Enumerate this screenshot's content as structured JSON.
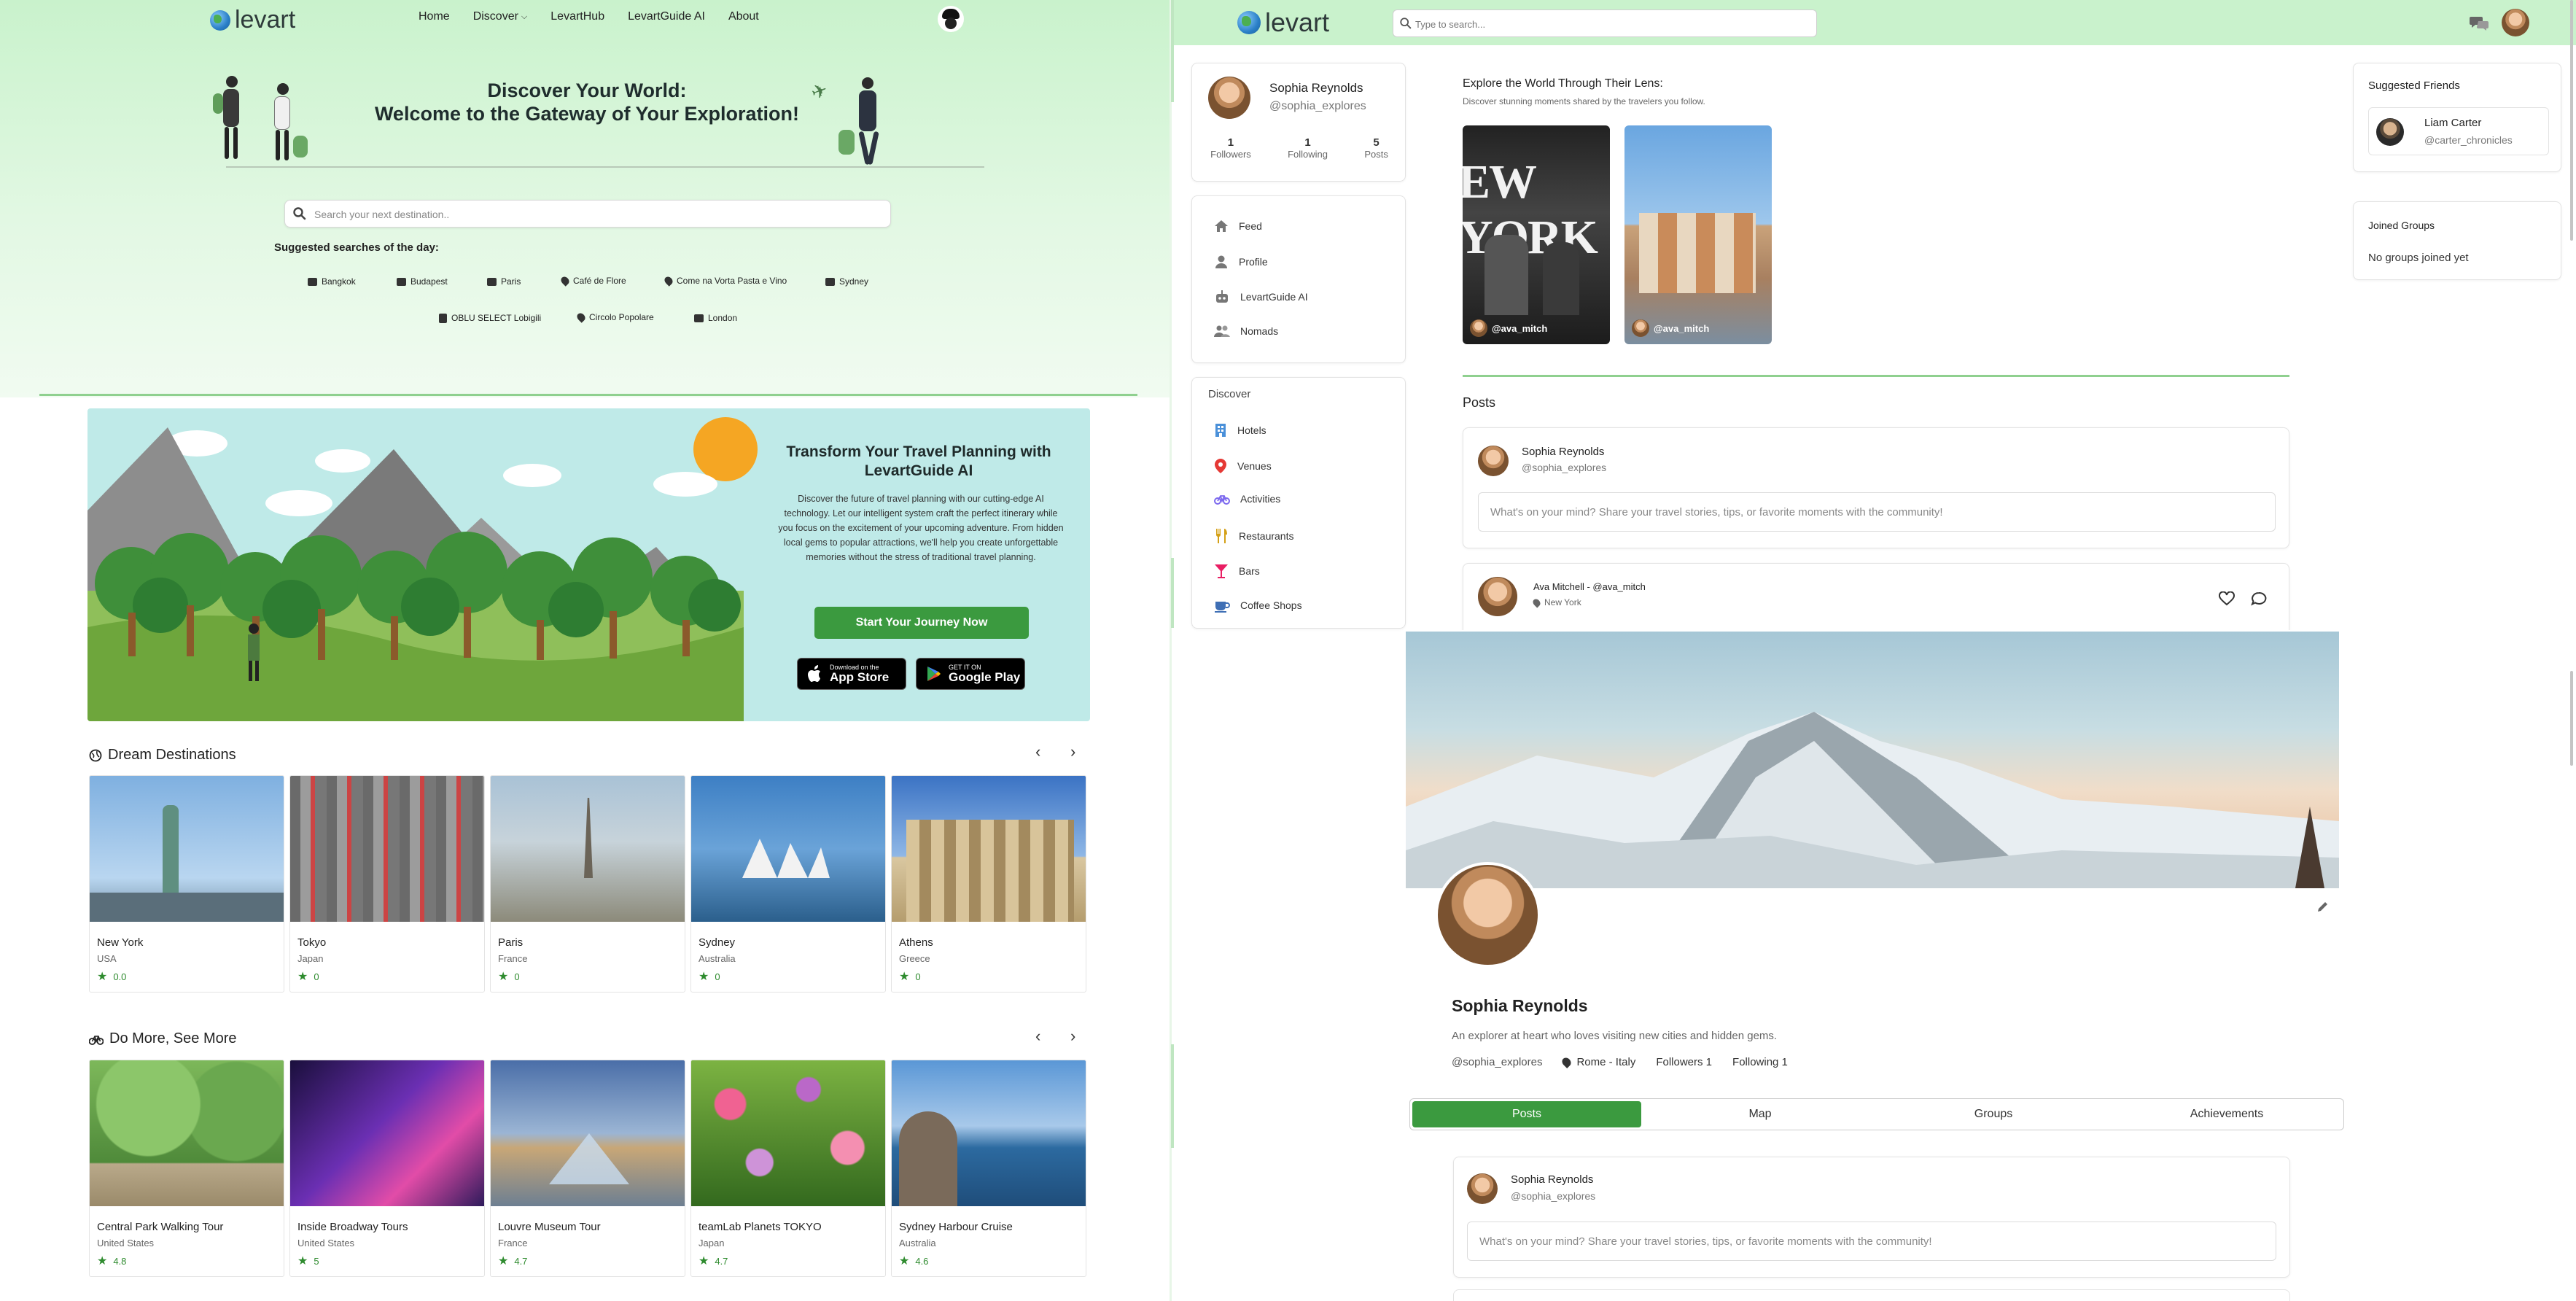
{
  "left_page": {
    "brand": "levart",
    "nav": {
      "items": [
        "Home",
        "Discover",
        "LevartHub",
        "LevartGuide AI",
        "About"
      ],
      "dropdown_icon": "chevron-down-icon"
    },
    "hero": {
      "title_line1": "Discover Your World:",
      "title_line2": "Welcome to the Gateway of Your Exploration!"
    },
    "search": {
      "placeholder": "Search your next destination.."
    },
    "suggestions": {
      "title": "Suggested searches of the day:",
      "items": [
        {
          "label": "Bangkok",
          "icon": "city-icon"
        },
        {
          "label": "Budapest",
          "icon": "city-icon"
        },
        {
          "label": "Paris",
          "icon": "city-icon"
        },
        {
          "label": "Café de Flore",
          "icon": "pin-icon"
        },
        {
          "label": "Come na Vorta Pasta e Vino",
          "icon": "pin-icon"
        },
        {
          "label": "Sydney",
          "icon": "city-icon"
        },
        {
          "label": "OBLU SELECT Lobigili",
          "icon": "hotel-icon"
        },
        {
          "label": "Circolo Popolare",
          "icon": "pin-icon"
        },
        {
          "label": "London",
          "icon": "city-icon"
        }
      ]
    },
    "banner": {
      "title_line1": "Transform Your Travel Planning with",
      "title_line2": "LevartGuide AI",
      "text": "Discover the future of travel planning with our cutting-edge AI technology. Let our intelligent system craft the perfect itinerary while you focus on the excitement of your upcoming adventure. From hidden local gems to popular attractions, we'll help you create unforgettable memories without the stress of traditional travel planning.",
      "cta": "Start Your Journey Now",
      "appstore_small": "Download on the",
      "appstore_big": "App Store",
      "googleplay_small": "GET IT ON",
      "googleplay_big": "Google Play"
    },
    "dream": {
      "title": "Dream Destinations",
      "cards": [
        {
          "name": "New York",
          "country": "USA",
          "rating": "0.0"
        },
        {
          "name": "Tokyo",
          "country": "Japan",
          "rating": "0"
        },
        {
          "name": "Paris",
          "country": "France",
          "rating": "0"
        },
        {
          "name": "Sydney",
          "country": "Australia",
          "rating": "0"
        },
        {
          "name": "Athens",
          "country": "Greece",
          "rating": "0"
        }
      ]
    },
    "domore": {
      "title": "Do More, See More",
      "cards": [
        {
          "name": "Central Park Walking Tour",
          "country": "United States",
          "rating": "4.8"
        },
        {
          "name": "Inside Broadway Tours",
          "country": "United States",
          "rating": "5"
        },
        {
          "name": "Louvre Museum Tour",
          "country": "France",
          "rating": "4.7"
        },
        {
          "name": "teamLab Planets TOKYO",
          "country": "Japan",
          "rating": "4.7"
        },
        {
          "name": "Sydney Harbour Cruise",
          "country": "Australia",
          "rating": "4.6"
        }
      ]
    }
  },
  "right_page": {
    "brand": "levart",
    "search_placeholder": "Type to search...",
    "profile_card": {
      "name": "Sophia Reynolds",
      "handle": "@sophia_explores",
      "stats": [
        {
          "value": "1",
          "label": "Followers"
        },
        {
          "value": "1",
          "label": "Following"
        },
        {
          "value": "5",
          "label": "Posts"
        }
      ]
    },
    "menu": [
      "Feed",
      "Profile",
      "LevartGuide AI",
      "Nomads"
    ],
    "discover": {
      "title": "Discover",
      "items": [
        "Hotels",
        "Venues",
        "Activities",
        "Restaurants",
        "Bars",
        "Coffee Shops"
      ]
    },
    "explore": {
      "title": "Explore the World Through Their Lens:",
      "subtitle": "Discover stunning moments shared by the travelers you follow.",
      "stories": [
        {
          "handle": "@ava_mitch",
          "overlay": "EW YORK"
        },
        {
          "handle": "@ava_mitch"
        }
      ]
    },
    "posts": {
      "title": "Posts",
      "composer_name": "Sophia Reynolds",
      "composer_handle": "@sophia_explores",
      "composer_placeholder": "What's on your mind? Share your travel stories, tips, or favorite moments with the community!",
      "feed_author": "Ava Mitchell - @ava_mitch",
      "feed_location": "New York"
    },
    "suggested": {
      "title": "Suggested Friends",
      "friend_name": "Liam Carter",
      "friend_handle": "@carter_chronicles"
    },
    "groups": {
      "title": "Joined Groups",
      "empty": "No groups joined yet"
    },
    "profile": {
      "name": "Sophia Reynolds",
      "bio": "An explorer at heart who loves visiting new cities and hidden gems.",
      "handle": "@sophia_explores",
      "location": "Rome - Italy",
      "followers": "Followers 1",
      "following": "Following 1",
      "tabs": [
        "Posts",
        "Map",
        "Groups",
        "Achievements"
      ],
      "composer_name": "Sophia Reynolds",
      "composer_handle": "@sophia_explores",
      "composer_placeholder": "What's on your mind? Share your travel stories, tips, or favorite moments with the community!"
    }
  },
  "colors": {
    "brand_green": "#3b9a3f",
    "hero_bg": "#c9f2cc",
    "banner_bg": "#bfeae8"
  }
}
